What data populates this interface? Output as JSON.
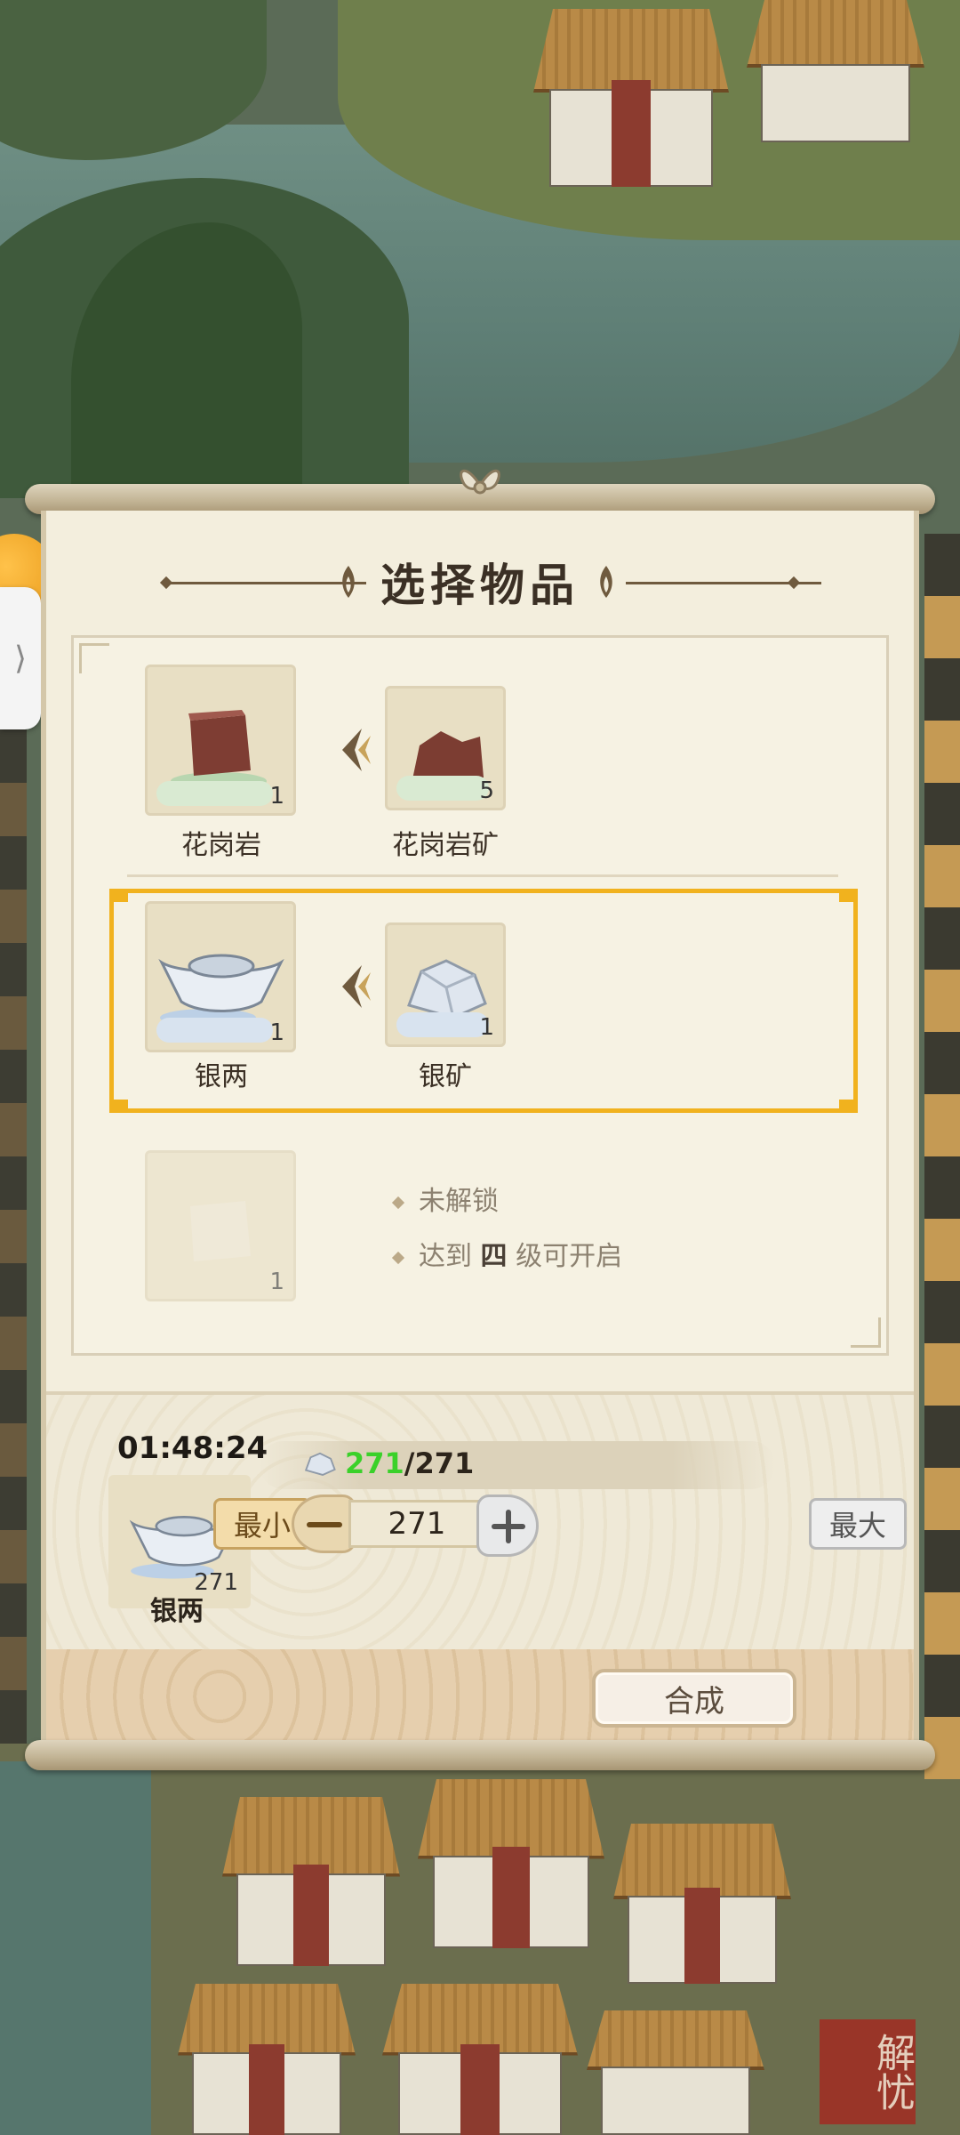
{
  "dialog": {
    "title": "选择物品",
    "recipes": [
      {
        "output": {
          "name": "花岗岩",
          "count": "1",
          "icon": "granite-block-icon"
        },
        "input": {
          "name": "花岗岩矿",
          "count": "5",
          "icon": "granite-ore-icon"
        }
      },
      {
        "output": {
          "name": "银两",
          "count": "1",
          "icon": "silver-ingot-icon"
        },
        "input": {
          "name": "银矿",
          "count": "1",
          "icon": "silver-ore-icon"
        },
        "selected": true
      },
      {
        "output": {
          "count": "1",
          "icon": "marble-block-icon"
        },
        "locked_text": "未解锁",
        "unlock_prefix": "达到",
        "unlock_level": "四",
        "unlock_suffix": "级可开启"
      }
    ]
  },
  "craft": {
    "timer": "01:48:24",
    "result_name": "银两",
    "result_count": "271",
    "cost_have": "271",
    "cost_total": "/271",
    "min_label": "最小",
    "max_label": "最大",
    "quantity": "271",
    "craft_label": "合成"
  },
  "corner_seal": "解忧",
  "colors": {
    "selection": "#f1b21e",
    "have_amount": "#3ad12a"
  }
}
